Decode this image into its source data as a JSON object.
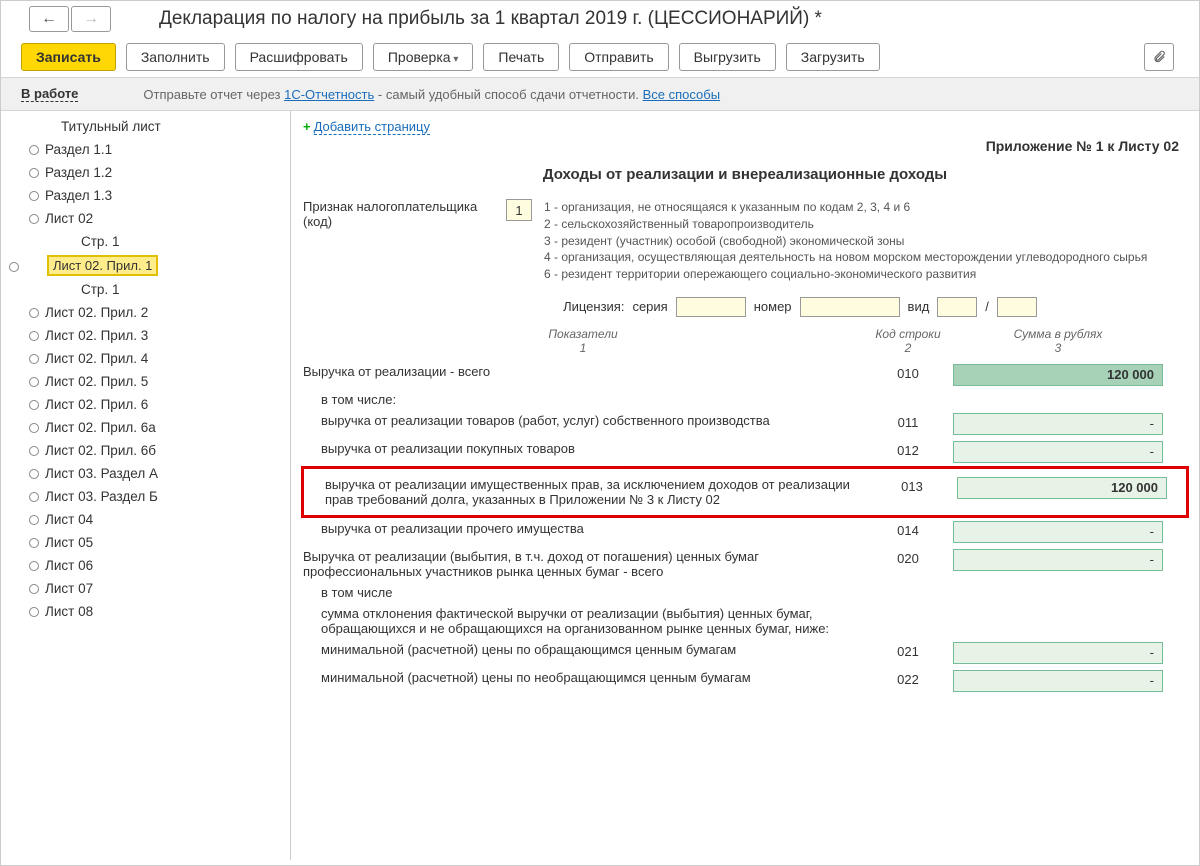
{
  "header": {
    "title": "Декларация по налогу на прибыль за 1 квартал 2019 г. (ЦЕССИОНАРИЙ) *"
  },
  "toolbar": {
    "write": "Записать",
    "fill": "Заполнить",
    "decrypt": "Расшифровать",
    "check": "Проверка",
    "print": "Печать",
    "send": "Отправить",
    "upload": "Выгрузить",
    "download": "Загрузить"
  },
  "status": {
    "label": "В работе",
    "text": "Отправьте отчет через ",
    "link1": "1С-Отчетность",
    "text2": " - самый удобный способ сдачи отчетности. ",
    "link2": "Все способы"
  },
  "tree": {
    "items": [
      "Титульный лист",
      "Раздел 1.1",
      "Раздел 1.2",
      "Раздел 1.3",
      "Лист 02",
      "Лист 02. Прил. 1",
      "Лист 02. Прил. 2",
      "Лист 02. Прил. 3",
      "Лист 02. Прил. 4",
      "Лист 02. Прил. 5",
      "Лист 02. Прил. 6",
      "Лист 02. Прил. 6а",
      "Лист 02. Прил. 6б",
      "Лист 03. Раздел А",
      "Лист 03. Раздел Б",
      "Лист 04",
      "Лист 05",
      "Лист 06",
      "Лист 07",
      "Лист 08"
    ],
    "page": "Стр. 1"
  },
  "main": {
    "add_page": "Добавить страницу",
    "app_title": "Приложение № 1 к Листу 02",
    "sec_title": "Доходы от реализации и внереализационные доходы",
    "tax_label": "Признак налогоплательщика (код)",
    "tax_code": "1",
    "codes": {
      "c1": "1 - организация, не относящаяся к указанным по кодам 2, 3, 4 и 6",
      "c2": "2 - сельскохозяйственный товаропроизводитель",
      "c3": "3 - резидент (участник) особой (свободной) экономической зоны",
      "c4": "4 - организация, осуществляющая деятельность на новом морском месторождении углеводородного сырья",
      "c6": "6 - резидент территории опережающего социально-экономического развития"
    },
    "license": "Лицензия:",
    "series": "серия",
    "number": "номер",
    "type": "вид",
    "col_ind": "Показатели",
    "col_code": "Код строки",
    "col_sum": "Сумма в рублях",
    "n1": "1",
    "n2": "2",
    "n3": "3",
    "rows": [
      {
        "label": "Выручка от реализации - всего",
        "code": "010",
        "sum": "120 000",
        "total": true
      },
      {
        "label": "в том числе:",
        "code": "",
        "sum": ""
      },
      {
        "label": "выручка от реализации товаров (работ, услуг) собственного производства",
        "code": "011",
        "sum": "-"
      },
      {
        "label": "выручка от реализации покупных товаров",
        "code": "012",
        "sum": "-"
      },
      {
        "label": "выручка от реализации имущественных прав, за исключением доходов от реализации прав требований долга, указанных в Приложении № 3 к Листу 02",
        "code": "013",
        "sum": "120 000",
        "hl": true
      },
      {
        "label": "выручка от реализации прочего имущества",
        "code": "014",
        "sum": "-"
      },
      {
        "label": "Выручка от реализации (выбытия, в т.ч. доход от погашения) ценных бумаг профессиональных участников рынка ценных бумаг - всего",
        "code": "020",
        "sum": "-"
      },
      {
        "label": "в том числе",
        "code": "",
        "sum": ""
      },
      {
        "label": "сумма отклонения фактической выручки от реализации (выбытия) ценных бумаг, обращающихся и не обращающихся на организованном рынке ценных бумаг, ниже:",
        "code": "",
        "sum": ""
      },
      {
        "label": "минимальной (расчетной) цены по обращающимся ценным бумагам",
        "code": "021",
        "sum": "-"
      },
      {
        "label": "минимальной (расчетной) цены по необращающимся ценным бумагам",
        "code": "022",
        "sum": "-"
      }
    ]
  }
}
